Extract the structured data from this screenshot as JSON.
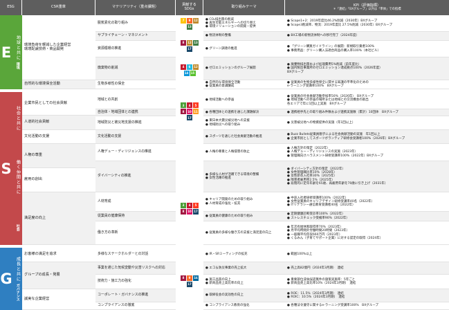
{
  "header": {
    "esg": "ESG",
    "csr": "CSR重章",
    "materiality": "マテリアリティ（重点課題）",
    "sdgs": "貢献する\nSDGs",
    "theme": "取り組みテーマ",
    "kpi": "KPI（評価指標）",
    "kpi_note": "＊「連結」「BXグループ」以外は「単体」での指標"
  },
  "colors": {
    "E": "#5aa63a",
    "S": "#c3494b",
    "G": "#2f7fc1",
    "header": "#5e5e5e",
    "stripe": "#f1f1f1"
  },
  "sections": {
    "E": {
      "letter": "E",
      "title": "地球と共に",
      "sub": "環境"
    },
    "S": {
      "letter": "S",
      "title1": "社会と共に",
      "title2": "働く仲間と共に",
      "sub": "社会"
    },
    "G": {
      "letter": "G",
      "title": "成長と共に",
      "sub": "ガバナンス"
    }
  },
  "csr": [
    "環境負荷を軽減した企業経営\n環境配慮技術・商品開発",
    "自然的な環境保全活動",
    "企業市民としての社会貢献",
    "人道的社会貢献",
    "文化活動の支援",
    "人権の尊重",
    "雇用の創出",
    "満足度の向上",
    "お客様の満足を追求",
    "グループの成長・発展",
    "誠実な企業経営"
  ],
  "materiality": [
    "脱炭素化の取り組み",
    "サプライチェーン・マネジメント",
    "資源循環の推進",
    "廃棄物の削減",
    "生物多様性の保全",
    "地域との共創",
    "自治体・地域団体との連携",
    "地域防災と被災地支援の推進",
    "文化活動の支援",
    "人権デュー・ディリジェンスの推進",
    "ダイバーシティの推進",
    "人材育成",
    "従業員の健康保持",
    "働き方の革新",
    "多様なステークホルダーとの対話",
    "事業を通じた気候変動や災害リスクへの対応",
    "技術力・施工力の強化",
    "コーポレート・ガバナンスの推進",
    "コンプライアンスの徹底"
  ],
  "themes": [
    [
      "● CO₂排出量の削減",
      "● 再生可能エネルギーへの切り替え",
      "● 環境ソリューションの開発・提供"
    ],
    [
      "● 物流体制の整備"
    ],
    [
      "● グリーン調達の推進"
    ],
    [
      "● ゼロエミッションのグループ展開"
    ],
    [
      "● 自然的な環境保全活動",
      "● 従業員の意識醸成"
    ],
    [
      "● 地域活動への参画"
    ],
    [
      "● 各種団体との連携を通じた課題解決"
    ],
    [
      "● 東日本大震災被災地への支援",
      "● 地域防災への取り組み"
    ],
    [
      "● スポーツを通じた社会貢献活動の推進"
    ],
    [
      "● 人権の尊重と人権侵害の防止"
    ],
    [
      "● 多様な人材が活躍できる環境の整備",
      "● 女性活躍の推進"
    ],
    [
      "● キャリア開発のための取り組み",
      "● 人材育成の強化・拡充"
    ],
    [
      "● 従業員の健康のための取り組み"
    ],
    [
      "● 従業員の多様な働き方の支援と満足度の向上"
    ],
    [
      "● IR・SRミーティングの拡充"
    ],
    [
      "● エコ＆防災事業の売上拡大"
    ],
    [
      "● 施工品質の向上",
      "● 新商品売上高比率の向上"
    ],
    [
      "● 取締役会の実効性の向上"
    ],
    [
      "● コンプライアンス教育の強化"
    ]
  ],
  "kpis": [
    [
      "● Scope1+2：2019年度比46.2%削減（2030年）BXグループ",
      "● Scope3削減率、物流：2019年度比 27.5%削減（2030年）BXグループ"
    ],
    [
      "● BX工場の新物流体制への移行完了（2024年度）"
    ],
    [
      "● 「グリーン購買ガイドライン」の展開：新規取引業者100%",
      "● 事務用品：グリーン購入法適合商品の購入率100%（本社ビル）"
    ],
    [
      "● 廃棄物排出量および処理費用5%削減（前年度比）",
      "● 国内製造事業所のゼロエミッション達成拠点100%（2026年度）",
      "   BXグループ"
    ],
    [
      "● 従業員の生物多様性保全に関する知識の平準化のための",
      "   e-ラーニング受講率100%　BXグループ"
    ],
    [
      "● 従業員の社会貢献活動参加率50%（2026年）　BXグループ",
      "● 地域活動への参画の場所または地域との交流機会の創出",
      "   各エリアで年に1回以上実施　BXグループ"
    ],
    [
      "● 連携相手先との取り組み件数および連携実施数（累計）10団体　BXグループ"
    ],
    [
      "● 災害被災地への物資提供の実施（年1回以上）"
    ],
    [
      "● Buzz Bullets従業員親子による社会貢献活動の実施　年1回以上",
      "● 企業市民としてスポーツボランティア研修会受講者100%（2026年）BXグループ"
    ],
    [
      "● 人権方針の策定（2022年）",
      "● 人権デュー・ディリジェンスの実施（2023年）",
      "● 管理職向けハラスメント研修受講率100%（2022年）BXグループ"
    ],
    [
      "● ダイバーシティ方針の策定（2022年）",
      "● 女性管理職比率10%（2028年）",
      "● 女性新卒入社率30%（2025年）",
      "● 障害者雇用率2.5%（2025年）",
      "● 段階的に定年年齢を65歳、再雇用年齢を70歳に引き上げ（2031年）"
    ],
    [
      "● 中途入社者研修受講率100%（2022年）",
      "● 女性従業員のキャリアデザイン研修受講率40名（2022年）",
      "● ITリテラシー通信教育受講者40名（2022年）"
    ],
    [
      "● 定期健康診断受診率100%（2022年）",
      "● ストレスチェック受検率90%（2022年）"
    ],
    [
      "● 年次有給休暇取得率70%（2023年）",
      "● 月平均時間外労働時間20時間（2023年）",
      "● 一般職平均年収660万円（2023年）",
      "● くるみん（子育てサポート企業）に対する認定の取得（2024年）"
    ],
    [
      "● 範囲100%以上"
    ],
    [
      "● 売上高82億円（2024年3月期）　連結"
    ],
    [
      "● 重要部位浸食誤認無件の施策実施率：5年ごと",
      "● 新商品売上高比率10%（2024年3月期）　連結"
    ],
    [
      "● ROE：11.5%（2024年3月期）　連結",
      "● ROIC：10.5%（2024年3月期）　連結"
    ],
    [
      "● 各種法令遵守に関するe-ラーニング受講率100%　BXグループ"
    ]
  ],
  "sdg_groups": [
    [
      "7",
      "9",
      "12",
      "13"
    ],
    [
      "8",
      "12",
      "13",
      "17"
    ],
    [
      "4",
      "6",
      "12",
      "14",
      "15"
    ],
    [
      "3",
      "4",
      "5",
      "8",
      "10",
      "11",
      "17"
    ],
    [
      "3",
      "4",
      "5",
      "8",
      "10",
      "17"
    ],
    [
      "8",
      "9",
      "16",
      "17"
    ]
  ]
}
